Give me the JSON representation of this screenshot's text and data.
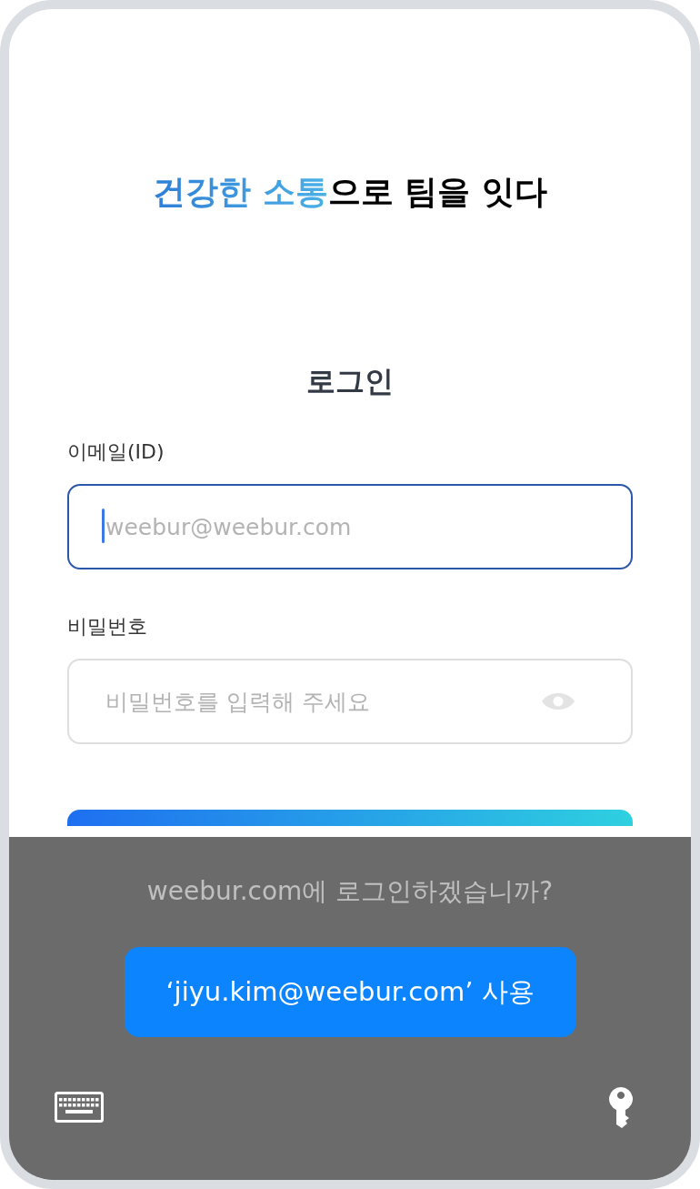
{
  "headline": {
    "highlight": "건강한 소통",
    "rest": "으로 팀을 잇다"
  },
  "login_title": "로그인",
  "fields": [
    {
      "label": "이메일(ID)",
      "placeholder": "weebur@weebur.com",
      "focused": true,
      "kind": "email"
    },
    {
      "label": "비밀번호",
      "placeholder": "비밀번호를 입력해 주세요",
      "focused": false,
      "kind": "password"
    }
  ],
  "autofill_sheet": {
    "prompt": "weebur.com에 로그인하겠습니까?",
    "button": "‘jiyu.kim@weebur.com’ 사용"
  }
}
